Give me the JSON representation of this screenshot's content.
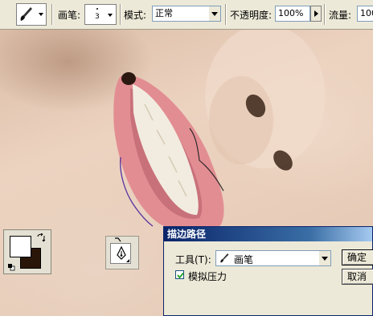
{
  "toolbar": {
    "brush_label": "画笔:",
    "brush_size": "3",
    "mode_label": "模式:",
    "mode_value": "正常",
    "opacity_label": "不透明度:",
    "opacity_value": "100%",
    "flow_label": "流量:",
    "flow_value": "100"
  },
  "toolbox": {
    "foreground_color": "#ffffff",
    "background_color": "#2a1608"
  },
  "dialog": {
    "title": "描边路径",
    "tool_label": "工具(T):",
    "tool_value": "画笔",
    "simulate_pressure_label": "模拟压力",
    "simulate_pressure_checked": true,
    "ok_label": "确定",
    "cancel_label": "取消"
  }
}
